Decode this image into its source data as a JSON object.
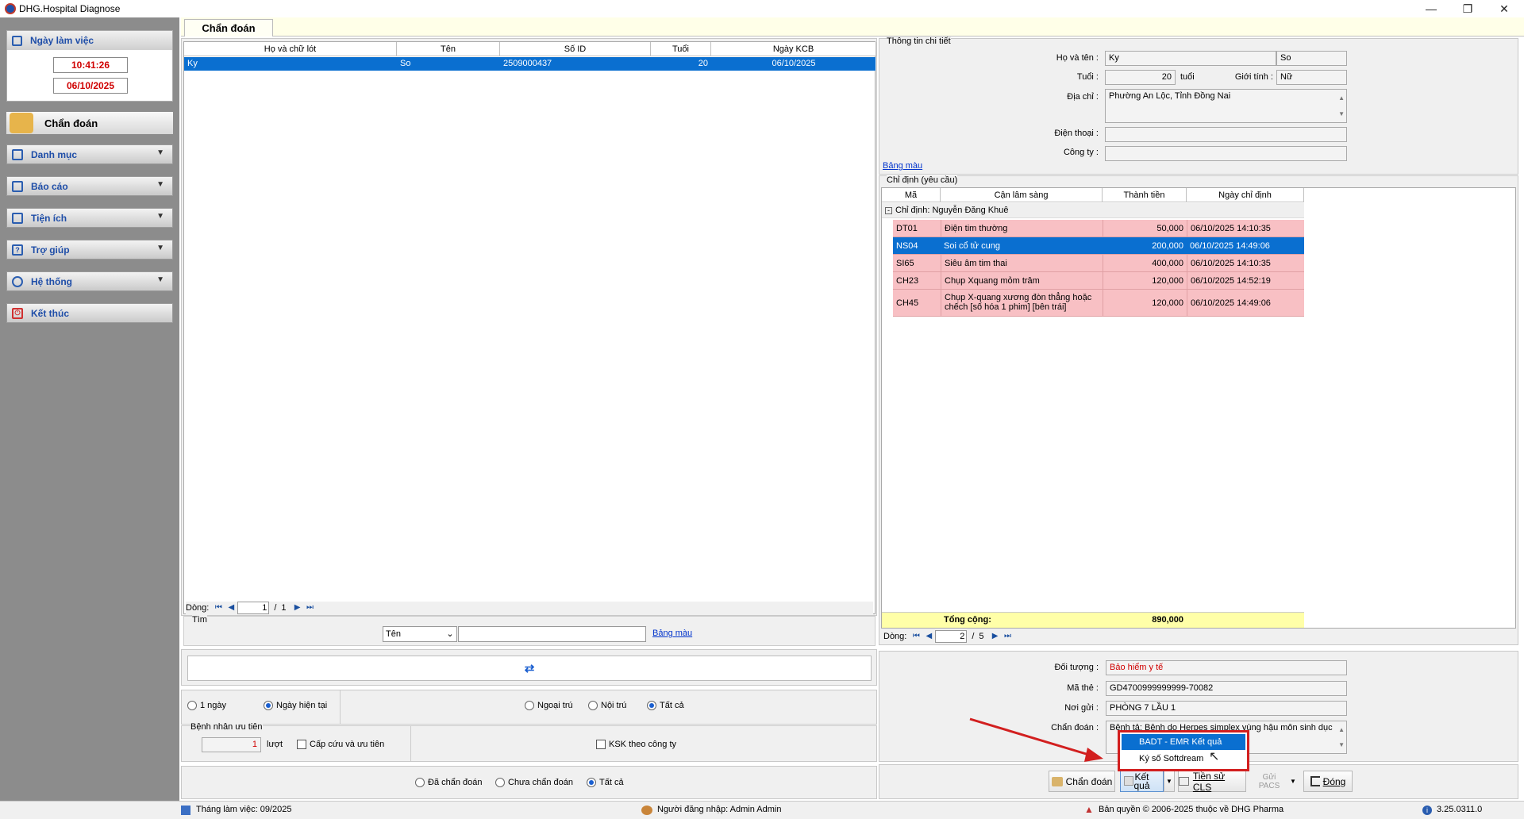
{
  "window": {
    "title": "DHG.Hospital Diagnose"
  },
  "sidebar": {
    "workday_label": "Ngày làm việc",
    "time": "10:41:26",
    "date": "06/10/2025",
    "active_item": "Chẩn đoán",
    "items": [
      {
        "label": "Danh mục",
        "icon": "list-icon"
      },
      {
        "label": "Báo cáo",
        "icon": "report-icon"
      },
      {
        "label": "Tiện ích",
        "icon": "utility-icon"
      },
      {
        "label": "Trợ giúp",
        "icon": "help-icon"
      },
      {
        "label": "Hệ thống",
        "icon": "gear-icon"
      },
      {
        "label": "Kết thúc",
        "icon": "power-icon"
      }
    ]
  },
  "tab": {
    "label": "Chẩn đoán"
  },
  "patient_grid": {
    "columns": [
      "Họ và chữ lót",
      "Tên",
      "Số ID",
      "Tuổi",
      "Ngày KCB"
    ],
    "rows": [
      [
        "Ky",
        "So",
        "2509000437",
        "20",
        "06/10/2025"
      ]
    ],
    "nav": {
      "label": "Dòng:",
      "page": "1",
      "total": "1"
    }
  },
  "search": {
    "group_label": "Tìm",
    "field_select": "Tên",
    "value": "",
    "color_link": "Bảng màu"
  },
  "filters": {
    "date_options": [
      "1 ngày",
      "Ngày hiện tại"
    ],
    "date_selected": "Ngày hiện tại",
    "visit_options": [
      "Ngoại trú",
      "Nội trú",
      "Tất cả"
    ],
    "visit_selected": "Tất cả",
    "priority_group": "Bệnh nhân ưu tiên",
    "priority_count": "1",
    "priority_unit": "lượt",
    "emergency_label": "Cấp cứu và ưu tiên",
    "ksk_label": "KSK theo công ty",
    "diag_options": [
      "Đã chẩn đoán",
      "Chưa chẩn đoán",
      "Tất cả"
    ],
    "diag_selected": "Tất cả"
  },
  "detail": {
    "group_label": "Thông tin chi tiết",
    "name_label": "Họ và tên :",
    "last_name": "Ky",
    "first_name": "So",
    "age_label": "Tuổi :",
    "age": "20",
    "age_unit": "tuổi",
    "gender_label": "Giới tính :",
    "gender": "Nữ",
    "address_label": "Địa chỉ :",
    "address": "Phường An Lộc, Tỉnh Đồng Nai",
    "phone_label": "Điện thoại :",
    "phone": "",
    "company_label": "Công ty :",
    "company": "",
    "color_link": "Bảng màu"
  },
  "orders": {
    "group_label": "Chỉ định (yêu cầu)",
    "columns": [
      "Mã",
      "Cận lâm sàng",
      "Thành tiền",
      "Ngày chỉ định"
    ],
    "group_row": "Chỉ định:  Nguyễn Đăng Khuê",
    "rows": [
      {
        "code": "DT01",
        "name": "Điện tim thường",
        "amount": "50,000",
        "date": "06/10/2025 14:10:35"
      },
      {
        "code": "NS04",
        "name": "Soi cổ tử cung",
        "amount": "200,000",
        "date": "06/10/2025 14:49:06"
      },
      {
        "code": "SI65",
        "name": "Siêu âm tim thai",
        "amount": "400,000",
        "date": "06/10/2025 14:10:35"
      },
      {
        "code": "CH23",
        "name": "Chụp Xquang mỏm trâm",
        "amount": "120,000",
        "date": "06/10/2025 14:52:19"
      },
      {
        "code": "CH45",
        "name": "Chụp X-quang xương đòn thẳng hoặc chếch [số hóa 1 phim] [bên trái]",
        "amount": "120,000",
        "date": "06/10/2025 14:49:06"
      }
    ],
    "total_label": "Tổng cộng:",
    "total": "890,000",
    "nav": {
      "label": "Dòng:",
      "page": "2",
      "total": "5"
    }
  },
  "insurance": {
    "object_label": "Đối tượng :",
    "object": "Bảo hiểm y tế",
    "card_label": "Mã thẻ :",
    "card": "GD4700999999999-70082",
    "sender_label": "Nơi gửi :",
    "sender": "PHÒNG 7 LẦU 1",
    "diagnosis_label": "Chẩn đoán :",
    "diagnosis": "Bệnh tả; Bệnh do Herpes simplex vùng hậu môn sinh dục"
  },
  "dropdown_menu": {
    "items": [
      "BADT - EMR Kết quả",
      "Ký số Softdream"
    ]
  },
  "actions": {
    "diagnose": "Chẩn đoán",
    "result_line1": "Kết",
    "result_line2": "quả",
    "cls_history": "Tiền sử CLS",
    "pacs_line1": "Gửi",
    "pacs_line2": "PACS",
    "close": "Đóng"
  },
  "statusbar": {
    "work_month": "Tháng làm việc: 09/2025",
    "user": "Người đăng nhập: Admin Admin",
    "copyright": "Bản quyền © 2006-2025 thuộc về DHG Pharma",
    "version": "3.25.0311.0"
  },
  "colors": {
    "accent": "#0a6fd0",
    "highlight_row": "#f8c0c4",
    "total_row": "#ffffa8",
    "red_text": "#d00000",
    "callout": "#d21f1f"
  }
}
